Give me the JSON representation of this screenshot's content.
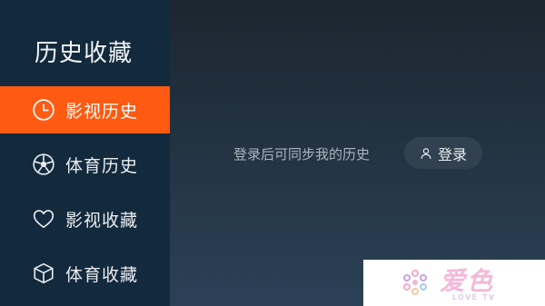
{
  "sidebar": {
    "title": "历史收藏",
    "items": [
      {
        "label": "影视历史",
        "icon": "clock-icon",
        "active": true
      },
      {
        "label": "体育历史",
        "icon": "soccer-ball-icon",
        "active": false
      },
      {
        "label": "影视收藏",
        "icon": "heart-icon",
        "active": false
      },
      {
        "label": "体育收藏",
        "icon": "cube-icon",
        "active": false
      }
    ]
  },
  "main": {
    "prompt": "登录后可同步我的历史",
    "login_button": {
      "label": "登录",
      "icon": "user-icon"
    }
  },
  "watermark": {
    "brand": "爱色",
    "subtitle": "LOVE TV"
  },
  "colors": {
    "active_item": "#ff5a12",
    "sidebar_bg": "#132a3d",
    "main_bg": "#243545"
  }
}
